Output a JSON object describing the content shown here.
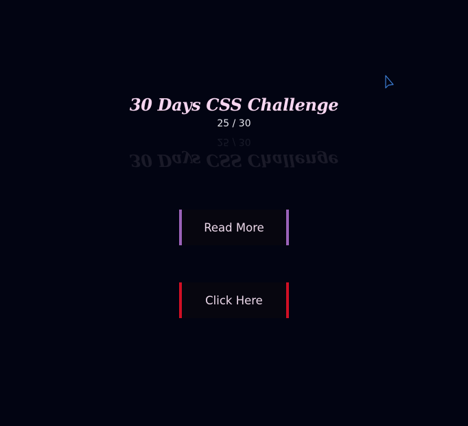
{
  "header": {
    "title": "30 Days CSS Challenge",
    "counter": "25 / 30"
  },
  "buttons": {
    "read_more_label": "Read More",
    "click_here_label": "Click Here"
  },
  "icons": {
    "cursor": "mouse-pointer-icon"
  },
  "colors": {
    "background": "#020412",
    "title": "#f6d6f0",
    "read_more_accent": "#9b62b8",
    "click_here_accent": "#d10f24"
  }
}
